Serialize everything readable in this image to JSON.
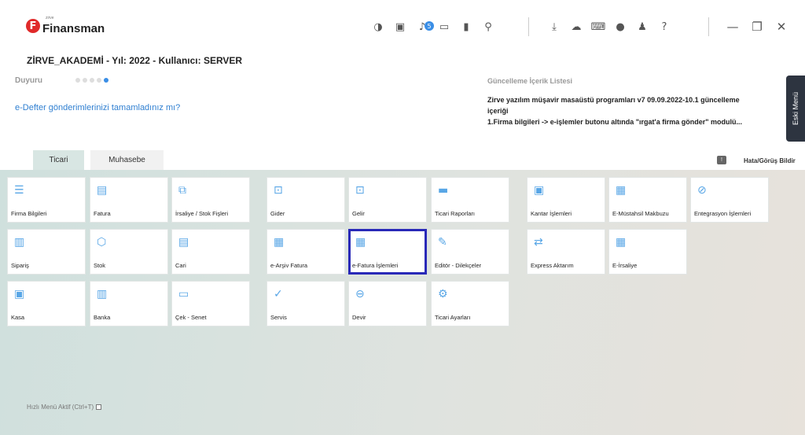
{
  "app": {
    "logo_small": "zirve",
    "logo_text": "Finansman"
  },
  "header": {
    "company_line": "ZİRVE_AKADEMİ - Yıl: 2022 - Kullanıcı: SERVER"
  },
  "announcement": {
    "label": "Duyuru",
    "dots": 5,
    "active_dot": 4,
    "text": "e-Defter gönderimlerinizi tamamladınız mı?"
  },
  "update_list": {
    "title": "Güncelleme İçerik Listesi",
    "line1": "Zirve yazılım müşavir masaüstü programları v7 09.09.2022-10.1 güncelleme",
    "line2": "içeriği",
    "line3": "1.Firma bilgileri -> e-işlemler butonu altında \"ırgat'a firma gönder\" modulü..."
  },
  "eski_menu": "Eski Menü",
  "tabs": [
    {
      "label": "Ticari",
      "active": true
    },
    {
      "label": "Muhasebe",
      "active": false
    }
  ],
  "feedback": {
    "label": "Hata/Görüş Bildir"
  },
  "notification_badge": "5",
  "tiles": [
    {
      "label": "Firma Bilgileri",
      "icon": "building-card-icon",
      "glyph": "☰"
    },
    {
      "label": "Fatura",
      "icon": "invoice-icon",
      "glyph": "▤"
    },
    {
      "label": "İrsaliye / Stok Fişleri",
      "icon": "waybill-icon",
      "glyph": "⧉"
    },
    {
      "label": "Gider",
      "icon": "expense-icon",
      "glyph": "⊡"
    },
    {
      "label": "Gelir",
      "icon": "income-icon",
      "glyph": "⊡"
    },
    {
      "label": "Ticari Raporları",
      "icon": "report-board-icon",
      "glyph": "▬"
    },
    {
      "label": "Kantar İşlemleri",
      "icon": "scale-icon",
      "glyph": "▣"
    },
    {
      "label": "E-Müstahsil Makbuzu",
      "icon": "e-receipt-icon",
      "glyph": "▦"
    },
    {
      "label": "Entegrasyon İşlemleri",
      "icon": "integration-icon",
      "glyph": "⊘"
    },
    {
      "label": "Sipariş",
      "icon": "order-icon",
      "glyph": "▥"
    },
    {
      "label": "Stok",
      "icon": "box-icon",
      "glyph": "⬡"
    },
    {
      "label": "Cari",
      "icon": "account-icon",
      "glyph": "▤"
    },
    {
      "label": "e-Arşiv Fatura",
      "icon": "e-archive-icon",
      "glyph": "▦"
    },
    {
      "label": "e-Fatura İşlemleri",
      "icon": "e-invoice-icon",
      "glyph": "▦"
    },
    {
      "label": "Editör - Dilekçeler",
      "icon": "editor-icon",
      "glyph": "✎"
    },
    {
      "label": "Express Aktarım",
      "icon": "transfer-icon",
      "glyph": "⇄"
    },
    {
      "label": "E-İrsaliye",
      "icon": "e-waybill-icon",
      "glyph": "▦"
    },
    {
      "label": "Kasa",
      "icon": "cashbox-icon",
      "glyph": "▣"
    },
    {
      "label": "Banka",
      "icon": "bank-icon",
      "glyph": "▥"
    },
    {
      "label": "Çek - Senet",
      "icon": "cheque-icon",
      "glyph": "▭"
    },
    {
      "label": "Servis",
      "icon": "wrench-icon",
      "glyph": "✓"
    },
    {
      "label": "Devir",
      "icon": "rollover-icon",
      "glyph": "⊖"
    },
    {
      "label": "Ticari Ayarları",
      "icon": "settings-gear-icon",
      "glyph": "⚙"
    }
  ],
  "selected_tile": "e-Fatura İşlemleri",
  "quick_menu": {
    "label": "Hızlı Menü Aktif (Ctrl+T)",
    "checked": false
  }
}
